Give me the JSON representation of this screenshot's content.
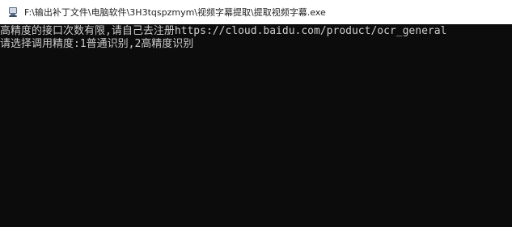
{
  "window": {
    "title": "F:\\输出补丁文件\\电脑软件\\3H3tqspzmym\\视频字幕提取\\提取视频字幕.exe",
    "icon": "console-app-icon"
  },
  "console": {
    "lines": [
      "高精度的接口次数有限,请自己去注册https://cloud.baidu.com/product/ocr_general",
      "请选择调用精度:1普通识别,2高精度识别"
    ],
    "background_color": "#0c0c0c",
    "text_color": "#cccccc"
  }
}
